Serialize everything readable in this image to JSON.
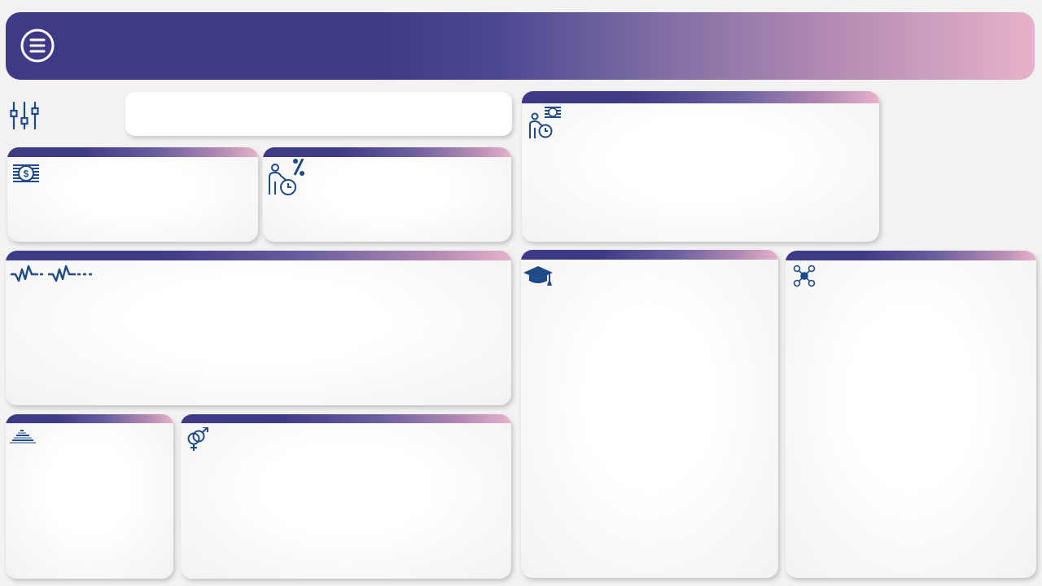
{
  "header": {
    "menu_icon": "hamburger-circle-icon",
    "title": ""
  },
  "filter": {
    "icon": "sliders-icon",
    "slicer_value": ""
  },
  "cards": [
    {
      "id": "income",
      "icon": "money-stack-icon",
      "title": ""
    },
    {
      "id": "rate",
      "icon": "worker-percent-clock-icon",
      "title": ""
    },
    {
      "id": "pay-time",
      "icon": "worker-money-clock-icon",
      "title": ""
    },
    {
      "id": "trend",
      "icon": "heartbeat-line-icon",
      "title": ""
    },
    {
      "id": "education",
      "icon": "graduation-cap-icon",
      "title": ""
    },
    {
      "id": "network",
      "icon": "people-network-icon",
      "title": ""
    },
    {
      "id": "pyramid",
      "icon": "population-pyramid-icon",
      "title": ""
    },
    {
      "id": "gender",
      "icon": "gender-symbol-icon",
      "title": ""
    }
  ],
  "colors": {
    "header_start": "#3f3a86",
    "header_end": "#e6b2c9",
    "icon": "#1f4a8a",
    "background": "#f2f2f2"
  }
}
